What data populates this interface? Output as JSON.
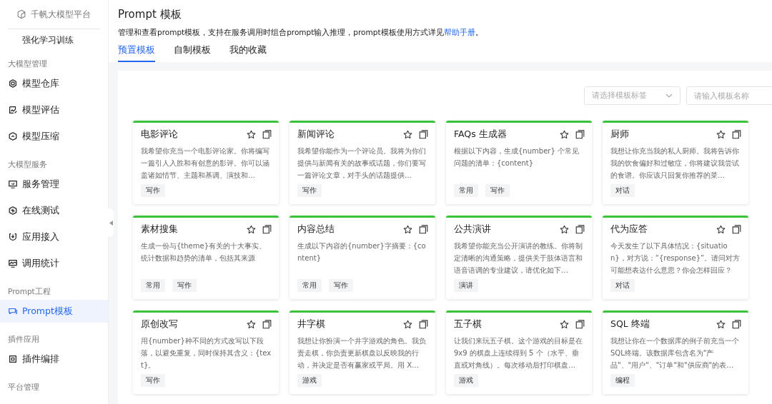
{
  "sidebar": {
    "brand": "千帆大模型平台",
    "top_item": "强化学习训练",
    "groups": [
      {
        "label": "大模型管理",
        "items": [
          {
            "label": "模型仓库",
            "selected": false
          },
          {
            "label": "模型评估",
            "selected": false
          },
          {
            "label": "模型压缩",
            "selected": false
          }
        ]
      },
      {
        "label": "大模型服务",
        "items": [
          {
            "label": "服务管理",
            "selected": false
          },
          {
            "label": "在线测试",
            "selected": false
          },
          {
            "label": "应用接入",
            "selected": false
          },
          {
            "label": "调用统计",
            "selected": false
          }
        ]
      },
      {
        "label": "Prompt工程",
        "items": [
          {
            "label": "Prompt模板",
            "selected": true
          }
        ]
      },
      {
        "label": "插件应用",
        "items": [
          {
            "label": "插件编排",
            "selected": false
          }
        ]
      },
      {
        "label": "平台管理"
      }
    ]
  },
  "header": {
    "title": "Prompt 模板",
    "description": "管理和查看prompt模板，支持在服务调用时组合prompt输入推理，prompt模板使用方式详见",
    "link": "帮助手册",
    "description_end": "。"
  },
  "tabs": [
    {
      "label": "预置模板",
      "selected": true
    },
    {
      "label": "自制模板",
      "selected": false
    },
    {
      "label": "我的收藏",
      "selected": false
    }
  ],
  "filters": {
    "tag_select": {
      "placeholder": "请选择模板标签"
    },
    "name_search": {
      "placeholder": "请输入模板名称"
    }
  },
  "cards": [
    {
      "title": "电影评论",
      "text": "我希望你充当一个电影评论家。你将编写一篇引人入胜和有创意的影评。你可以涵盖诸如情节、主题和基调、演技和…",
      "tags": [
        "写作"
      ]
    },
    {
      "title": "新闻评论",
      "text": "我希望你能作为一个评论员。我将为你们提供与新闻有关的故事或话题，你们要写一篇评论文章，对手头的话题提供…",
      "tags": [
        "写作"
      ]
    },
    {
      "title": "FAQs 生成器",
      "text": "根据以下内容，生成{number} 个常见问题的清单：{content}",
      "tags": [
        "常用",
        "写作"
      ]
    },
    {
      "title": "厨师",
      "text": "我想让你充当我的私人厨师。我将告诉你我的饮食偏好和过敏症，你将建议我尝试的食谱。你应该只回复你推荐的菜…",
      "tags": [
        "对话"
      ]
    },
    {
      "title": "素材搜集",
      "text": "生成一份与{theme}有关的十大事实、统计数据和趋势的清单，包括其来源",
      "tags": [
        "常用",
        "写作"
      ]
    },
    {
      "title": "内容总结",
      "text": "生成以下内容的{number}字摘要：{content}",
      "tags": [
        "常用",
        "写作"
      ]
    },
    {
      "title": "公共演讲",
      "text": "我希望你能充当公开演讲的教练。你将制定清晰的沟通策略，提供关于肢体语言和语音语调的专业建议，请优化如下…",
      "tags": [
        "演讲"
      ]
    },
    {
      "title": "代为应答",
      "text": "今天发生了以下具体情况：{situation}，对方说：“{response}”。请问对方可能想表达什么意思？你会怎样回应？",
      "tags": [
        "对话"
      ]
    },
    {
      "title": "原创改写",
      "text": "用{number}种不同的方式改写以下段落，以避免重复，同时保持其含义：{text}。",
      "tags": [
        "写作"
      ]
    },
    {
      "title": "井字棋",
      "text": "我想让你扮演一个井字游戏的角色。我负责走棋，你负责更新棋盘以反映我的行动，并决定是否有赢家或平局。用 X…",
      "tags": [
        "游戏"
      ]
    },
    {
      "title": "五子棋",
      "text": "让我们来玩五子棋。这个游戏的目标是在 9x9 的棋盘上连续得到 5 个（水平、垂直或对角线）。每次移动后打印棋盘…",
      "tags": [
        "游戏"
      ]
    },
    {
      "title": "SQL 终端",
      "text": "我想让你在一个数据库的例子前充当一个SQL终端。该数据库包含名为\"产品\"、\"用户\"、\"订单\"和\"供应商\"的表…",
      "tags": [
        "编程"
      ]
    }
  ]
}
